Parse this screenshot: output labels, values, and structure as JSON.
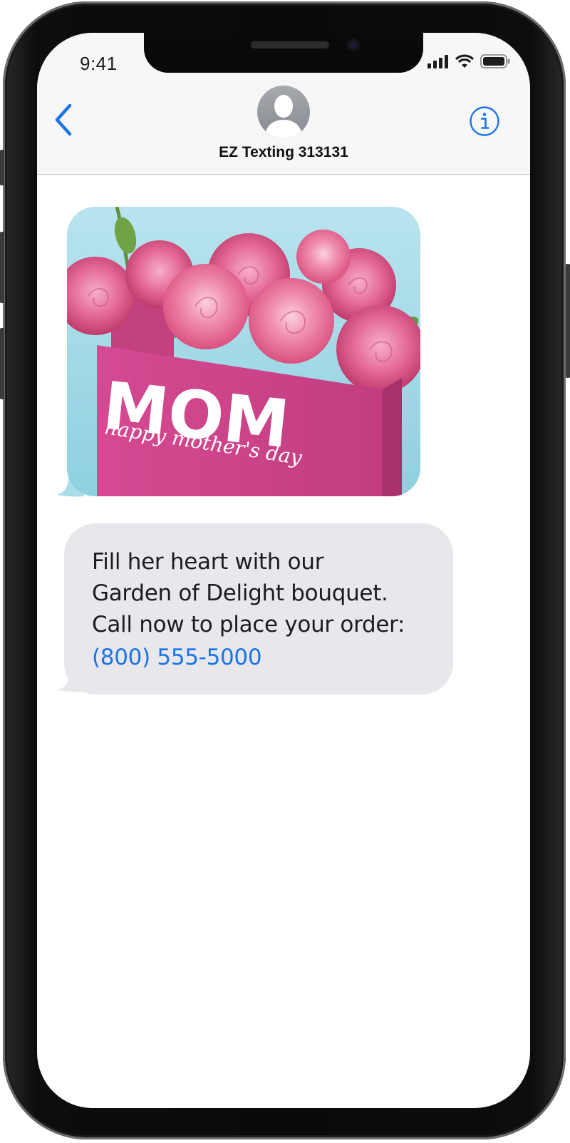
{
  "status_bar": {
    "time": "9:41"
  },
  "header": {
    "contact_name": "EZ Texting 313131"
  },
  "messages": {
    "image": {
      "big_text": "MOM",
      "script_text": "happy mother's day"
    },
    "text": {
      "line1": "Fill her heart with our",
      "line2": "Garden of Delight bouquet.",
      "line3": "Call now to place your order:",
      "phone": "(800) 555-5000"
    }
  },
  "colors": {
    "accent": "#1a74e6",
    "bubble_gray": "#e8e8ec",
    "header_bg": "#f7f7f7",
    "card_pink": "#d2468d",
    "image_bg": "#a9dde8"
  },
  "icons": {
    "back": "chevron-left-icon",
    "info": "info-circle-icon",
    "signal": "cellular-signal-icon",
    "wifi": "wifi-icon",
    "battery": "battery-icon",
    "avatar": "contact-avatar"
  }
}
